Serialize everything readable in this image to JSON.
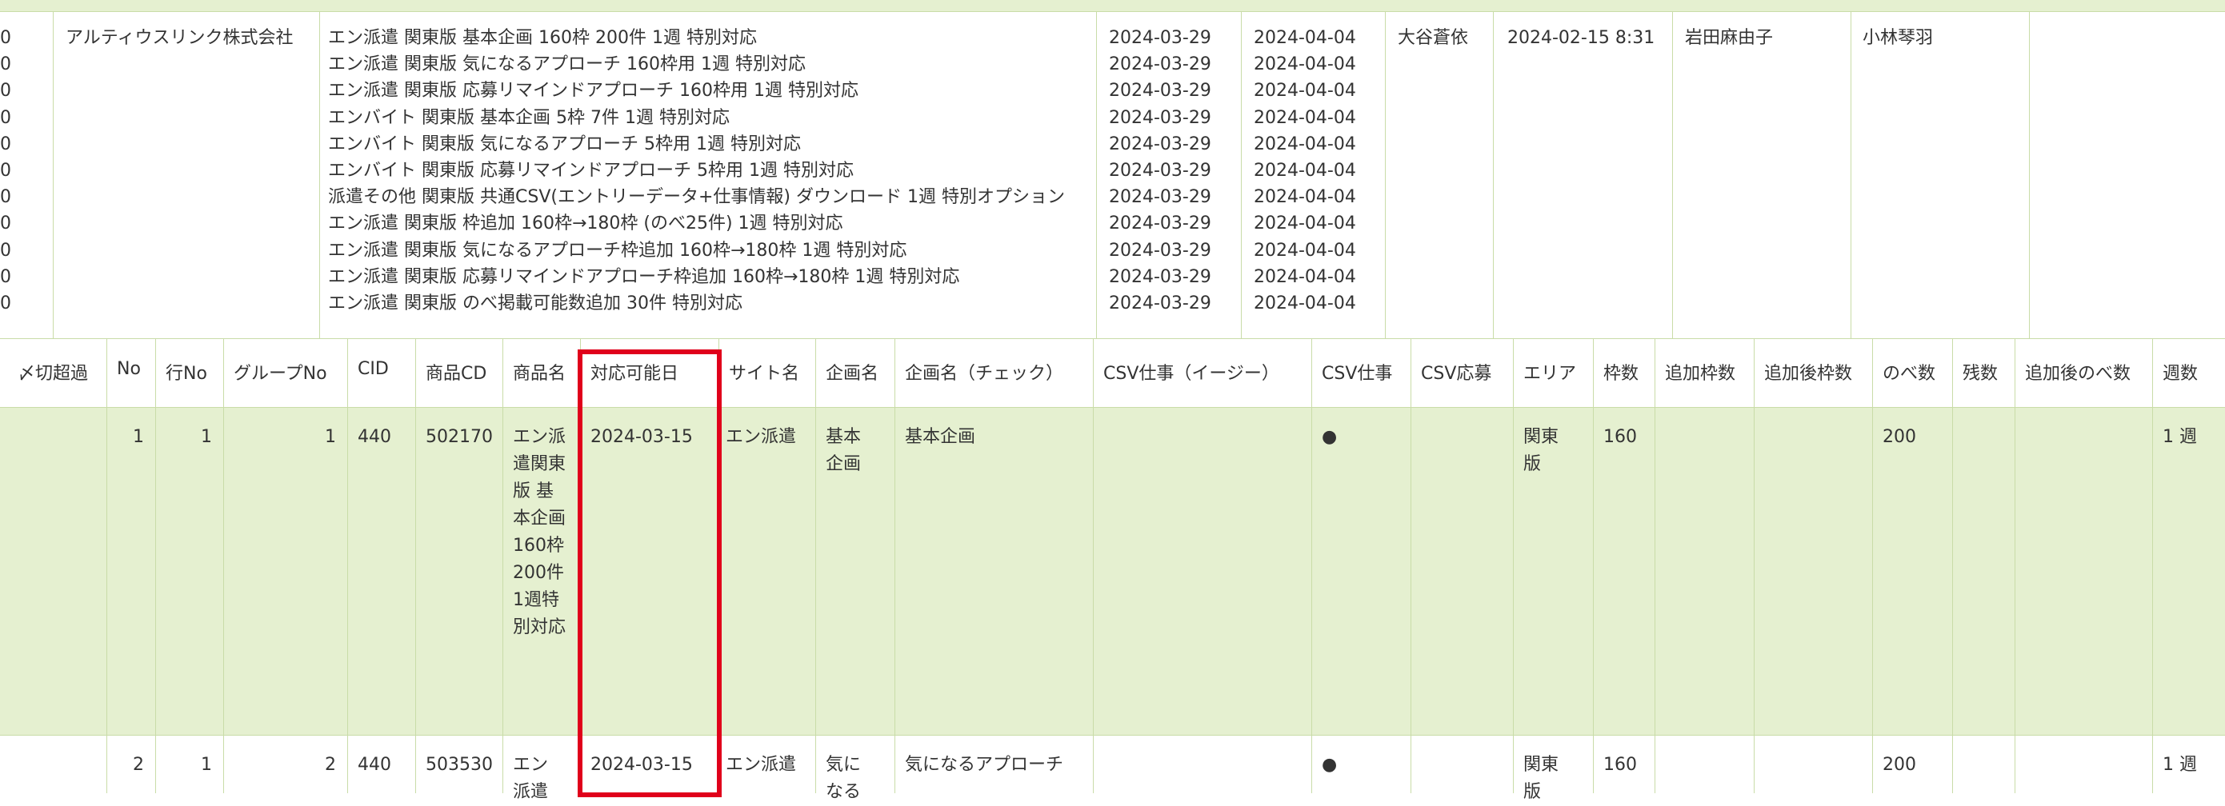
{
  "order": {
    "left_marks": [
      "0",
      "0",
      "0",
      "0",
      "0",
      "0",
      "0",
      "0",
      "0",
      "0",
      "0"
    ],
    "company": "アルティウスリンク株式会社",
    "products": [
      "エン派遣 関東版 基本企画 160枠 200件 1週 特別対応",
      "エン派遣 関東版 気になるアプローチ 160枠用 1週 特別対応",
      "エン派遣 関東版 応募リマインドアプローチ 160枠用 1週 特別対応",
      "エンバイト 関東版 基本企画 5枠 7件 1週 特別対応",
      "エンバイト 関東版 気になるアプローチ 5枠用 1週 特別対応",
      "エンバイト 関東版 応募リマインドアプローチ 5枠用 1週 特別対応",
      "派遣その他 関東版 共通CSV(エントリーデータ+仕事情報) ダウンロード 1週 特別オプション",
      "エン派遣 関東版 枠追加 160枠→180枠 (のべ25件) 1週 特別対応",
      "エン派遣 関東版 気になるアプローチ枠追加 160枠→180枠 1週 特別対応",
      "エン派遣 関東版 応募リマインドアプローチ枠追加 160枠→180枠 1週 特別対応",
      "エン派遣 関東版 のべ掲載可能数追加 30件 特別対応"
    ],
    "start_dates": [
      "2024-03-29",
      "2024-03-29",
      "2024-03-29",
      "2024-03-29",
      "2024-03-29",
      "2024-03-29",
      "2024-03-29",
      "2024-03-29",
      "2024-03-29",
      "2024-03-29",
      "2024-03-29"
    ],
    "end_dates": [
      "2024-04-04",
      "2024-04-04",
      "2024-04-04",
      "2024-04-04",
      "2024-04-04",
      "2024-04-04",
      "2024-04-04",
      "2024-04-04",
      "2024-04-04",
      "2024-04-04",
      "2024-04-04"
    ],
    "person1": "大谷蒼依",
    "datetime": "2024-02-15 8:31",
    "person2": "岩田麻由子",
    "person3": "小林琴羽"
  },
  "headers": {
    "deadline_over": "〆切超過",
    "no": "No",
    "row_no": "行No",
    "group_no": "グループNo",
    "cid": "CID",
    "product_cd": "商品CD",
    "product_name": "商品名",
    "available_date": "対応可能日",
    "site_name": "サイト名",
    "plan_name": "企画名",
    "plan_name_check": "企画名（チェック）",
    "csv_job_easy": "CSV仕事（イージー）",
    "csv_job": "CSV仕事",
    "csv_apply": "CSV応募",
    "area": "エリア",
    "slots": "枠数",
    "added_slots": "追加枠数",
    "slots_after_add": "追加後枠数",
    "total": "のべ数",
    "remaining": "残数",
    "total_after_add": "追加後のべ数",
    "weeks": "週数"
  },
  "rows": [
    {
      "no": "1",
      "row_no": "1",
      "group_no": "1",
      "cid": "440",
      "product_cd": "502170",
      "product_name": "エン派遣関東版 基本企画160枠200件1週特別対応",
      "available_date": "2024-03-15",
      "site_name": "エン派遣",
      "plan_name": "基本企画",
      "plan_name_check": "基本企画",
      "csv_job": "●",
      "area": "関東版",
      "slots": "160",
      "total": "200",
      "weeks": "1 週"
    },
    {
      "no": "2",
      "row_no": "1",
      "group_no": "2",
      "cid": "440",
      "product_cd": "503530",
      "product_name": "エン派遣",
      "available_date": "2024-03-15",
      "site_name": "エン派遣",
      "plan_name": "気になる",
      "plan_name_check": "気になるアプローチ",
      "csv_job": "●",
      "area": "関東版",
      "slots": "160",
      "total": "200",
      "weeks": "1 週"
    }
  ],
  "colors": {
    "row_highlight": "#e5f0d0",
    "border": "#c9dca8",
    "focus_box": "#e0001b"
  }
}
